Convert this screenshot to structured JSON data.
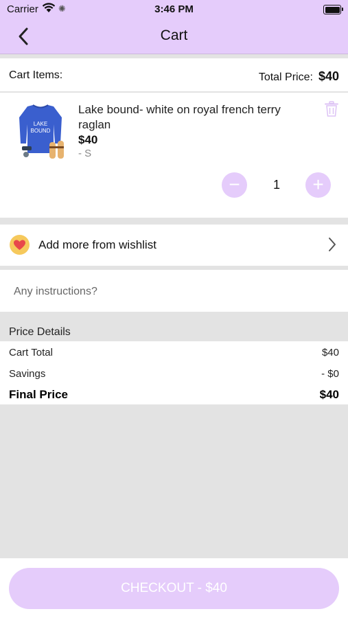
{
  "status_bar": {
    "carrier": "Carrier",
    "time": "3:46 PM"
  },
  "nav": {
    "title": "Cart",
    "back_icon": "chevron-left-icon"
  },
  "cart_header": {
    "items_label": "Cart Items:",
    "total_label": "Total Price:",
    "total_value": "$40"
  },
  "cart_items": [
    {
      "name": "Lake bound- white on royal french terry raglan",
      "price": "$40",
      "variant": "- S",
      "quantity": "1",
      "thumbnail_text": "LAKE BOUND",
      "delete_icon": "trash-icon"
    }
  ],
  "wishlist": {
    "label": "Add more from wishlist",
    "icon": "heart-icon",
    "chevron_icon": "chevron-right-icon"
  },
  "instructions": {
    "placeholder": "Any instructions?"
  },
  "price_details": {
    "header": "Price Details",
    "cart_total_label": "Cart Total",
    "cart_total_value": "$40",
    "savings_label": "Savings",
    "savings_value": "- $0",
    "final_label": "Final Price",
    "final_value": "$40"
  },
  "checkout": {
    "label": "CHECKOUT - $40"
  },
  "colors": {
    "accent": "#e5ccfb",
    "background": "#e3e3e3",
    "heart_badge": "#f6c95c",
    "heart": "#e8474b"
  }
}
